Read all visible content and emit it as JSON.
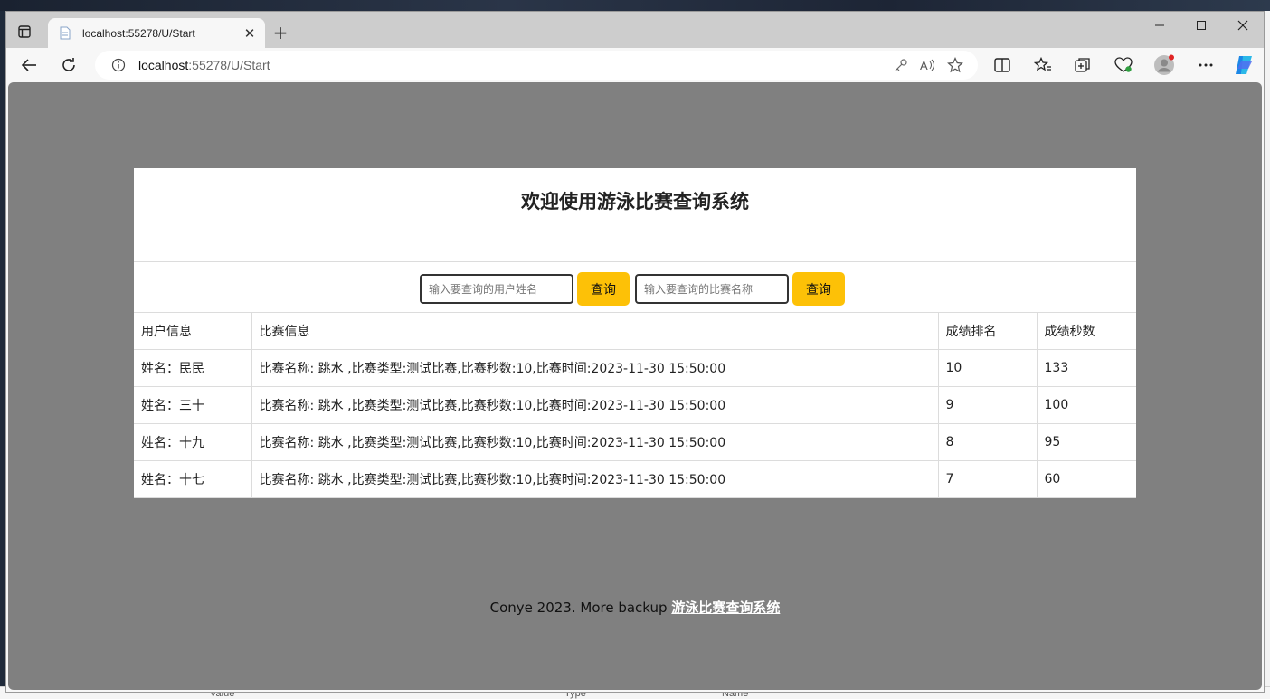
{
  "browser": {
    "tab_title": "localhost:55278/U/Start",
    "url_host": "localhost",
    "url_rest": ":55278/U/Start",
    "new_tab_symbol": "+",
    "tab_close_symbol": "✕"
  },
  "page": {
    "heading": "欢迎使用游泳比赛查询系统",
    "search": {
      "user_placeholder": "输入要查询的用户姓名",
      "user_button": "查询",
      "match_placeholder": "输入要查询的比赛名称",
      "match_button": "查询"
    },
    "table": {
      "headers": [
        "用户信息",
        "比赛信息",
        "成绩排名",
        "成绩秒数"
      ],
      "rows": [
        [
          "姓名：民民",
          "比赛名称: 跳水 ,比赛类型:测试比赛,比赛秒数:10,比赛时间:2023-11-30 15:50:00",
          "10",
          "133"
        ],
        [
          "姓名：三十",
          "比赛名称: 跳水 ,比赛类型:测试比赛,比赛秒数:10,比赛时间:2023-11-30 15:50:00",
          "9",
          "100"
        ],
        [
          "姓名：十九",
          "比赛名称: 跳水 ,比赛类型:测试比赛,比赛秒数:10,比赛时间:2023-11-30 15:50:00",
          "8",
          "95"
        ],
        [
          "姓名：十七",
          "比赛名称: 跳水 ,比赛类型:测试比赛,比赛秒数:10,比赛时间:2023-11-30 15:50:00",
          "7",
          "60"
        ]
      ]
    },
    "footer": {
      "text": "Conye 2023. More backup ",
      "link": "游泳比赛查询系统"
    }
  },
  "background_app": {
    "labels": [
      "Value",
      "Type",
      "Name"
    ]
  },
  "colors": {
    "page_background": "#808080",
    "button_accent": "#fdc107",
    "card_background": "#ffffff"
  }
}
